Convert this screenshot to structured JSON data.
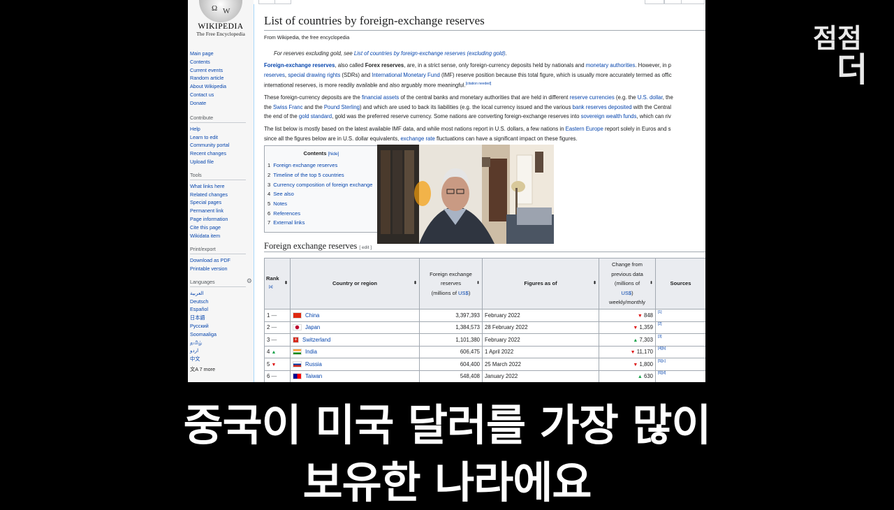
{
  "wiki": {
    "logo": {
      "wordmark": "WIKIPEDIA",
      "tagline": "The Free Encyclopedia"
    },
    "sidebar": {
      "main_links": [
        "Main page",
        "Contents",
        "Current events",
        "Random article",
        "About Wikipedia",
        "Contact us",
        "Donate"
      ],
      "contribute_heading": "Contribute",
      "contribute_links": [
        "Help",
        "Learn to edit",
        "Community portal",
        "Recent changes",
        "Upload file"
      ],
      "tools_heading": "Tools",
      "tools_links": [
        "What links here",
        "Related changes",
        "Special pages",
        "Permanent link",
        "Page information",
        "Cite this page",
        "Wikidata item"
      ],
      "print_heading": "Print/export",
      "print_links": [
        "Download as PDF",
        "Printable version"
      ],
      "languages_heading": "Languages",
      "language_links": [
        "العربية",
        "Deutsch",
        "Español",
        "日本語",
        "Русский",
        "Soomaaliga",
        "தமிழ்",
        "اردو",
        "中文"
      ],
      "more_languages": "文A 7 more"
    },
    "article": {
      "title": "List of countries by foreign-exchange reserves",
      "from": "From Wikipedia, the free encyclopedia",
      "hatnote_prefix": "For reserves excluding gold, see ",
      "hatnote_link": "List of countries by foreign-exchange reserves (excluding gold)",
      "hatnote_suffix": ".",
      "p1": {
        "l1_a": "Foreign-exchange reserves",
        "l1_b": ", also called ",
        "l1_c": "Forex reserves",
        "l1_d": ", are, in a strict sense, only foreign-currency deposits held by nationals and ",
        "l1_e": "monetary authorities",
        "l1_f": ". However, in p",
        "l2_a": "reserves",
        "l2_b": ", ",
        "l2_c": "special drawing rights",
        "l2_d": " (SDRs) and ",
        "l2_e": "International Monetary Fund",
        "l2_f": " (IMF) reserve position because this total figure, which is usually more accurately termed as offic",
        "l3_a": "international reserves, is more readily available and also arguably more meaningful.",
        "l3_cite": "[citation needed]"
      },
      "p2": {
        "l1_a": "These foreign-currency deposits are the ",
        "l1_b": "financial assets",
        "l1_c": " of the central banks and monetary authorities that are held in different ",
        "l1_d": "reserve currencies",
        "l1_e": " (e.g. the ",
        "l1_f": "U.S. dollar",
        "l1_g": ", the",
        "l2_a": "the ",
        "l2_b": "Swiss Franc",
        "l2_c": " and the ",
        "l2_d": "Pound Sterling",
        "l2_e": ") and which are used to back its liabilities (e.g. the local currency issued and the various ",
        "l2_f": "bank reserves deposited",
        "l2_g": " with the Central",
        "l3_a": "the end of the ",
        "l3_b": "gold standard",
        "l3_c": ", gold was the preferred reserve currency. Some nations are converting foreign-exchange reserves into ",
        "l3_d": "sovereign wealth funds",
        "l3_e": ", which can riv"
      },
      "p3": {
        "l1_a": "The list below is mostly based on the latest available IMF data, and while most nations report in U.S. dollars, a few nations in ",
        "l1_b": "Eastern Europe",
        "l1_c": " report solely in Euros and s",
        "l2_a": "since all the figures below are in U.S. dollar equivalents, ",
        "l2_b": "exchange rate",
        "l2_c": " fluctuations can have a significant impact on these figures."
      },
      "toc": {
        "title": "Contents",
        "hide": "[hide]",
        "items": [
          {
            "n": "1",
            "label": "Foreign exchange reserves"
          },
          {
            "n": "2",
            "label": "Timeline of the top 5 countries"
          },
          {
            "n": "3",
            "label": "Currency composition of foreign exchange"
          },
          {
            "n": "4",
            "label": "See also"
          },
          {
            "n": "5",
            "label": "Notes"
          },
          {
            "n": "6",
            "label": "References"
          },
          {
            "n": "7",
            "label": "External links"
          }
        ]
      },
      "section_heading": "Foreign exchange reserves",
      "section_edit": "[ edit ]",
      "table": {
        "headers": {
          "rank": "Rank",
          "rank_note": "[a]",
          "country": "Country or region",
          "reserves_l1": "Foreign exchange",
          "reserves_l2": "reserves",
          "reserves_l3": "(millions of ",
          "reserves_l3_link": "US$",
          "reserves_l3_end": ")",
          "asof": "Figures as of",
          "change_l1": "Change from",
          "change_l2": "previous data",
          "change_l3": "(millions of",
          "change_l4": "US$",
          "change_l5": ")",
          "change_l6": "weekly/monthly",
          "sources": "Sources"
        },
        "rows": [
          {
            "rank": "1",
            "rank_trend": "—",
            "country": "China",
            "reserves": "3,397,393",
            "asof": "February 2022",
            "change_dir": "▼",
            "change": "848",
            "src": "[1]"
          },
          {
            "rank": "2",
            "rank_trend": "—",
            "country": "Japan",
            "reserves": "1,384,573",
            "asof": "28 February 2022",
            "change_dir": "▼",
            "change": "1,359",
            "src": "[2]"
          },
          {
            "rank": "3",
            "rank_trend": "—",
            "country": "Switzerland",
            "reserves": "1,101,380",
            "asof": "February 2022",
            "change_dir": "▲",
            "change": "7,303",
            "src": "[3]"
          },
          {
            "rank": "4",
            "rank_trend": "▲",
            "country": "India",
            "reserves": "606,475",
            "asof": "1 April 2022",
            "change_dir": "▼",
            "change": "11,170",
            "src": "[4][b]"
          },
          {
            "rank": "5",
            "rank_trend": "▼",
            "country": "Russia",
            "reserves": "604,400",
            "asof": "25 March 2022",
            "change_dir": "▼",
            "change": "1,800",
            "src": "[5][c]"
          },
          {
            "rank": "6",
            "rank_trend": "—",
            "country": "Taiwan",
            "reserves": "548,408",
            "asof": "January 2022",
            "change_dir": "▲",
            "change": "630",
            "src": "[6][d]"
          }
        ]
      }
    }
  },
  "overlay": {
    "brand_logo": "점점 더",
    "subtitle_line1": "중국이 미국 달러를 가장 많이",
    "subtitle_line2": "보유한 나라에요"
  },
  "colors": {
    "link": "#0645ad",
    "up": "#16a34a",
    "down": "#dd1111",
    "background": "#000000"
  }
}
